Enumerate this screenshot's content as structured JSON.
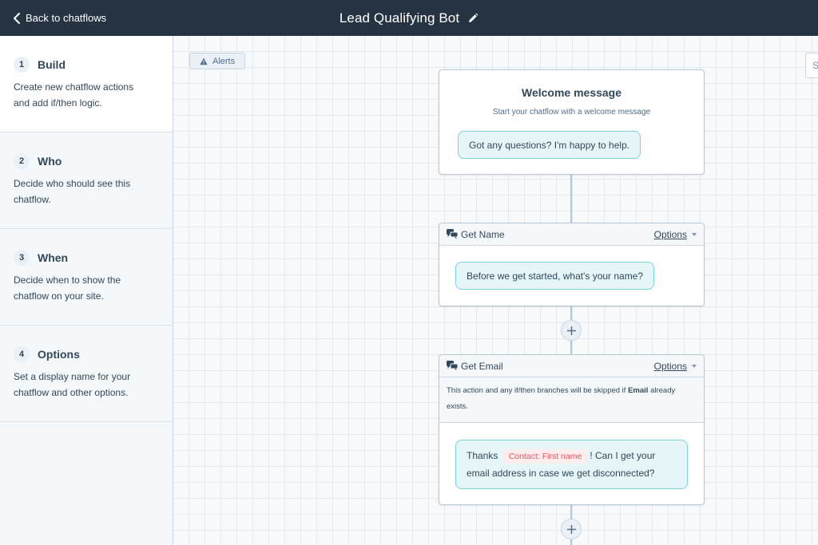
{
  "topbar": {
    "back_label": "Back to chatflows",
    "title": "Lead Qualifying Bot"
  },
  "sidebar": {
    "steps": [
      {
        "num": "1",
        "title": "Build",
        "desc": "Create new chatflow actions and add if/then logic."
      },
      {
        "num": "2",
        "title": "Who",
        "desc": "Decide who should see this chatflow."
      },
      {
        "num": "3",
        "title": "When",
        "desc": "Decide when to show the chatflow on your site."
      },
      {
        "num": "4",
        "title": "Options",
        "desc": "Set a display name for your chatflow and other options."
      }
    ]
  },
  "canvas": {
    "alerts_label": "Alerts",
    "edge_button_label": "S",
    "welcome": {
      "title": "Welcome message",
      "subtitle": "Start your chatflow with a welcome message",
      "message": "Got any questions? I'm happy to help."
    },
    "get_name": {
      "label": "Get Name",
      "options_label": "Options",
      "message": "Before we get started, what's your name?"
    },
    "get_email": {
      "label": "Get Email",
      "options_label": "Options",
      "note_prefix": "This action and any if/then branches will be skipped if ",
      "note_bold": "Email",
      "note_suffix": " already exists.",
      "message_prefix": "Thanks",
      "token": "Contact: First name",
      "message_suffix": "! Can I get your email address in case we get disconnected?"
    }
  }
}
